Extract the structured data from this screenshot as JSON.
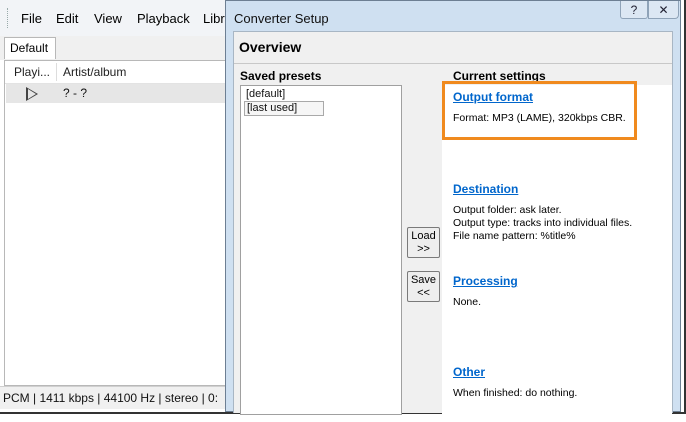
{
  "main_window": {
    "menu": [
      "File",
      "Edit",
      "View",
      "Playback",
      "Libr"
    ],
    "tab": "Default",
    "columns": [
      "Playi...",
      "Artist/album"
    ],
    "track": "? - ?",
    "status": "PCM | 1411 kbps | 44100 Hz | stereo | 0:"
  },
  "dialog": {
    "title": "Converter Setup",
    "help_label": "?",
    "close_label": "✕",
    "section": "Overview",
    "saved_presets": {
      "title": "Saved presets",
      "items": [
        "[default]",
        "[last used]"
      ]
    },
    "buttons": {
      "load": [
        "Load",
        ">>"
      ],
      "save": [
        "Save",
        "<<"
      ]
    },
    "current_settings": {
      "title": "Current settings",
      "output_format": {
        "label": "Output format",
        "desc": "Format: MP3 (LAME), 320kbps CBR."
      },
      "destination": {
        "label": "Destination",
        "lines": [
          "Output folder: ask later.",
          "Output type: tracks into individual files.",
          "File name pattern: %title%"
        ]
      },
      "processing": {
        "label": "Processing",
        "desc": "None."
      },
      "other": {
        "label": "Other",
        "desc": "When finished: do nothing."
      }
    }
  },
  "annotation": {
    "highlight_color": "#f08a1e"
  }
}
